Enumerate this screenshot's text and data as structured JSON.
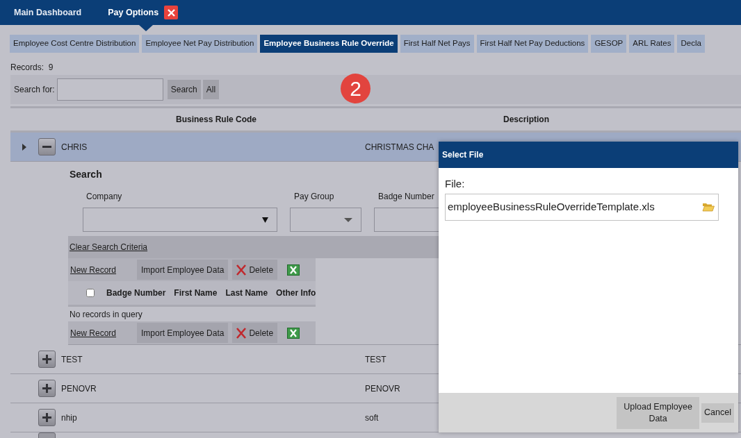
{
  "top_tabs": [
    {
      "label": "Main Dashboard",
      "selected": false,
      "closable": false
    },
    {
      "label": "Pay Options",
      "selected": true,
      "closable": true
    }
  ],
  "tabs": [
    {
      "label": "Employee Cost Centre Distribution",
      "selected": false
    },
    {
      "label": "Employee Net Pay Distribution",
      "selected": false
    },
    {
      "label": "Employee Business Rule Override",
      "selected": true
    },
    {
      "label": "First Half Net Pays",
      "selected": false
    },
    {
      "label": "First Half Net Pay Deductions",
      "selected": false
    },
    {
      "label": "GESOP",
      "selected": false
    },
    {
      "label": "ARL Rates",
      "selected": false
    },
    {
      "label": "Decla",
      "selected": false
    }
  ],
  "records": "Records:  9",
  "search": {
    "label": "Search for:",
    "button": "Search",
    "all_button": "All"
  },
  "step_badge": "2",
  "table": {
    "columns": [
      "Business Rule Code",
      "Description"
    ],
    "rows": [
      {
        "code": "CHRIS",
        "description": "CHRISTMAS CHA",
        "expanded": true,
        "selected": true
      },
      {
        "code": "TEST",
        "description": "TEST",
        "expanded": false,
        "selected": false
      },
      {
        "code": "PENOVR",
        "description": "PENOVR",
        "expanded": false,
        "selected": false
      },
      {
        "code": "nhip",
        "description": "soft",
        "expanded": false,
        "selected": false
      }
    ]
  },
  "detail": {
    "title": "Search",
    "filters": [
      {
        "label": "Company",
        "kind": "select"
      },
      {
        "label": "Pay Group",
        "kind": "dropdown"
      },
      {
        "label": "Badge Number",
        "kind": "text"
      }
    ],
    "clear": "Clear Search Criteria",
    "action_bars": [
      {
        "new_record": "New Record",
        "import": "Import Employee Data",
        "delete": "Delete"
      },
      {
        "new_record": "New Record",
        "import": "Import Employee Data",
        "delete": "Delete"
      }
    ],
    "columns": [
      "Badge Number",
      "First Name",
      "Last Name",
      "Other Info"
    ],
    "select_all_checked": false,
    "empty": "No records in query"
  },
  "dialog": {
    "title": "Select File",
    "file_label": "File:",
    "file_value": "employeeBusinessRuleOverrideTemplate.xls",
    "upload": "Upload Employee Data",
    "cancel": "Cancel"
  }
}
